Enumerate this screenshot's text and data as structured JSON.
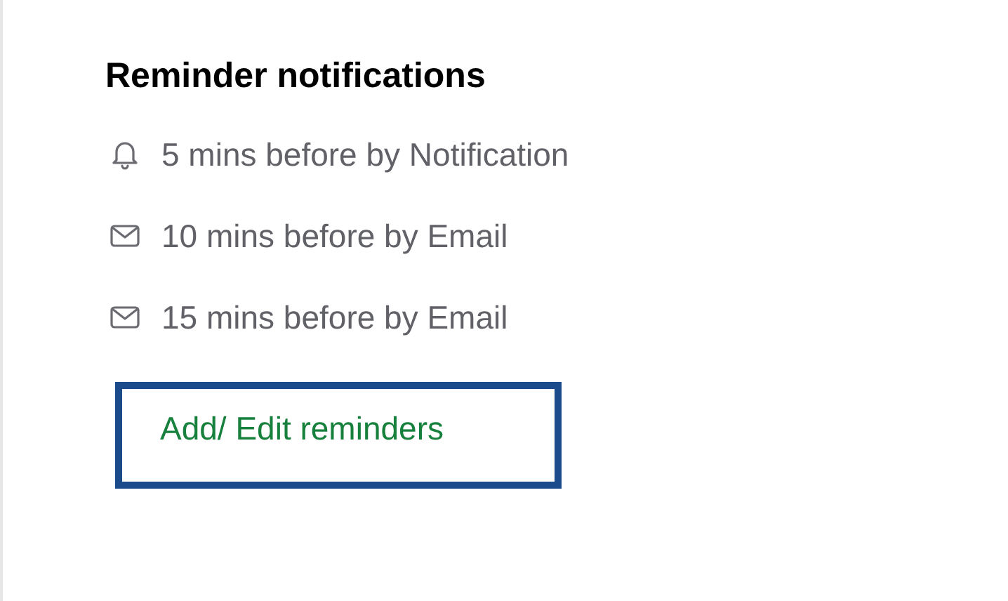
{
  "title": "Reminder notifications",
  "reminders": [
    {
      "kind": "bell",
      "text": "5 mins before by Notification"
    },
    {
      "kind": "mail",
      "text": "10 mins before by Email"
    },
    {
      "kind": "mail",
      "text": "15 mins before by Email"
    }
  ],
  "action": {
    "label": "Add/ Edit reminders"
  }
}
